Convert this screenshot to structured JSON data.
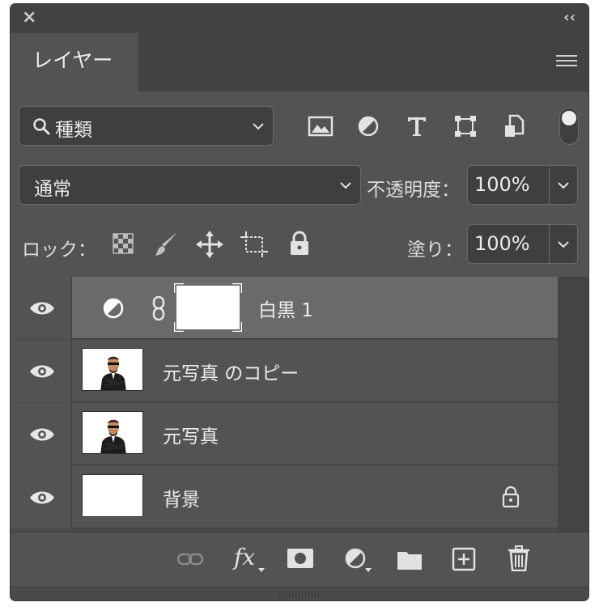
{
  "panel": {
    "tab_label": "レイヤー"
  },
  "filter": {
    "kind_label": "種類"
  },
  "blend": {
    "mode": "通常",
    "opacity_label": "不透明度：",
    "opacity_value": "100%"
  },
  "lock": {
    "label": "ロック：",
    "fill_label": "塗り：",
    "fill_value": "100%"
  },
  "layers": [
    {
      "name": "白黒 1"
    },
    {
      "name": "元写真 のコピー"
    },
    {
      "name": "元写真"
    },
    {
      "name": "背景"
    }
  ],
  "bottom": {
    "fx_label": "fx"
  }
}
